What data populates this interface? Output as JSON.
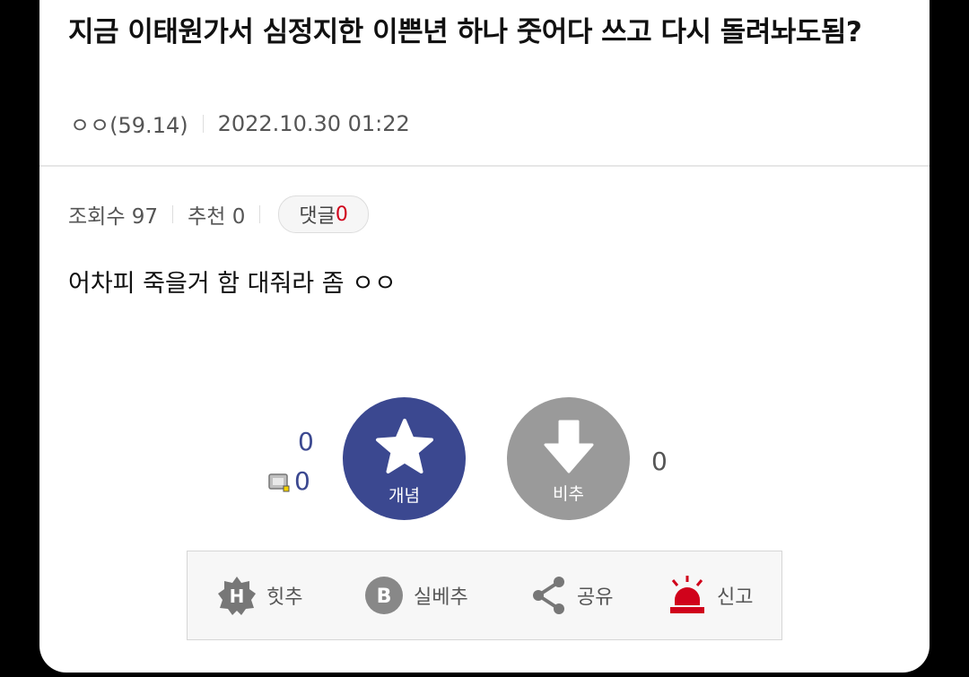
{
  "post": {
    "title": "지금 이태원가서 심정지한 이쁜년 하나 줏어다 쓰고 다시 돌려놔도됨?",
    "author": "ㅇㅇ(59.14)",
    "datetime": "2022.10.30 01:22",
    "views_label": "조회수 97",
    "recommend_label": "추천 0",
    "comment_label": "댓글",
    "comment_count": "0",
    "body": "어차피 죽을거 함 대줘라 좀 ㅇㅇ"
  },
  "vote": {
    "up_count": "0",
    "fixed_count": "0",
    "up_label": "개념",
    "down_label": "비추",
    "down_count": "0"
  },
  "actions": {
    "hit_label": "힛추",
    "best_label": "실베추",
    "share_label": "공유",
    "report_label": "신고"
  },
  "colors": {
    "up_button": "#3b4890",
    "down_button": "#9a9a9a",
    "comment_count": "#d0021b",
    "report_icon": "#d0021b"
  }
}
